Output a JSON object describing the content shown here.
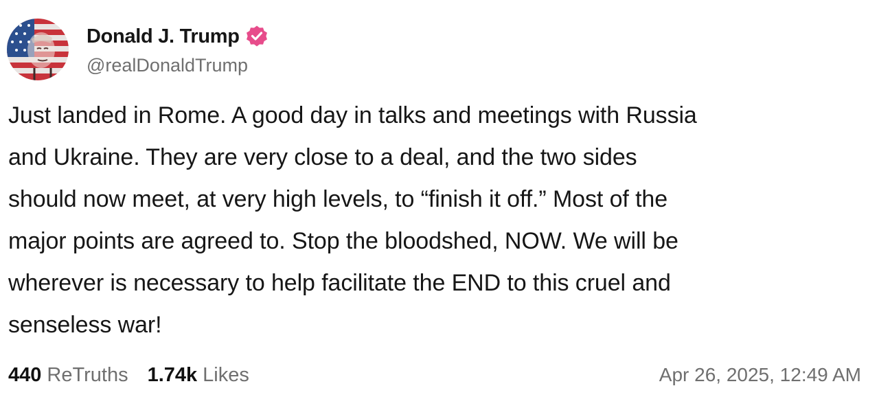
{
  "author": {
    "display_name": "Donald J. Trump",
    "handle": "@realDonaldTrump",
    "verified_color": "#e74c8b"
  },
  "post": {
    "text": "Just landed in Rome. A good day in talks and meetings with Russia\nand Ukraine. They are very close to a deal, and the two sides\nshould now meet, at very high levels, to “finish it off.” Most of the\nmajor points are agreed to. Stop the bloodshed, NOW. We will be\nwherever is necessary to help facilitate the END to this cruel and\nsenseless war!"
  },
  "stats": {
    "retruths_count": "440",
    "retruths_label": "ReTruths",
    "likes_count": "1.74k",
    "likes_label": "Likes"
  },
  "timestamp": "Apr 26, 2025, 12:49 AM",
  "icons": {
    "avatar": "avatar-flag-portrait",
    "verified": "verified-badge-icon"
  }
}
